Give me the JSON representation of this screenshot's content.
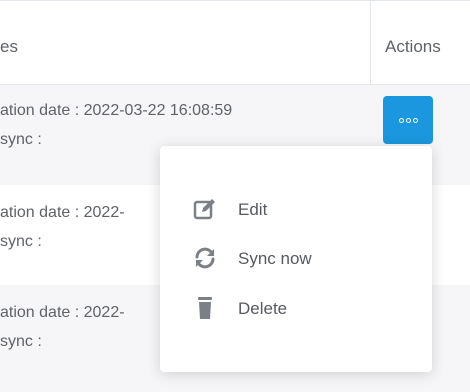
{
  "table": {
    "columns": {
      "dates_header": "es",
      "actions_header": "Actions"
    },
    "rows": [
      {
        "line1": "ation date : 2022-03-22 16:08:59",
        "line2": "sync :"
      },
      {
        "line1": "ation date : 2022-",
        "line2": "sync :"
      },
      {
        "line1": "ation date : 2022-",
        "line2": "sync :"
      }
    ]
  },
  "actions_button": {
    "icon": "ellipsis-icon",
    "color": "#1a97de"
  },
  "menu": {
    "items": [
      {
        "label": "Edit",
        "icon": "edit-icon"
      },
      {
        "label": "Sync now",
        "icon": "sync-icon"
      },
      {
        "label": "Delete",
        "icon": "trash-icon"
      }
    ]
  }
}
